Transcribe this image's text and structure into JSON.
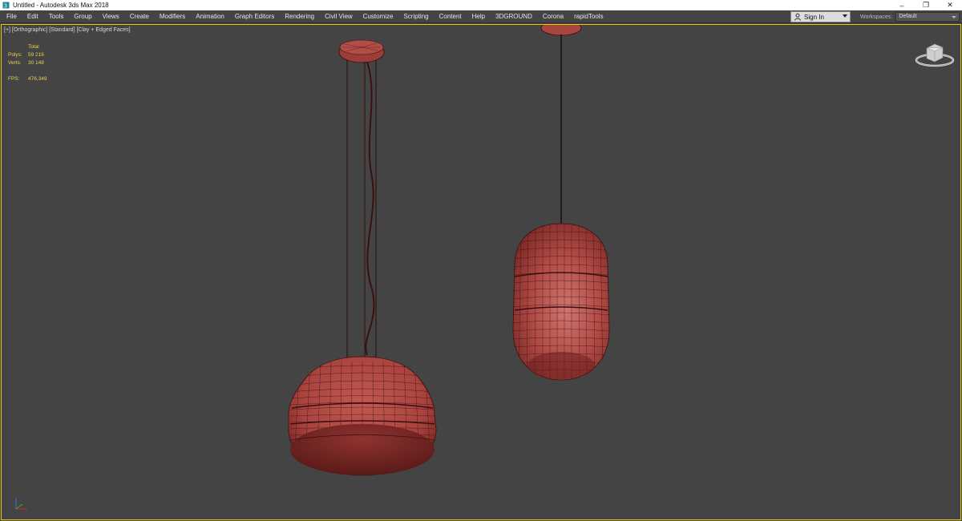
{
  "window": {
    "title": "Untitled - Autodesk 3ds Max 2018",
    "controls": {
      "minimize": "–",
      "restore": "❐",
      "close": "✕"
    }
  },
  "menu": {
    "items": [
      "File",
      "Edit",
      "Tools",
      "Group",
      "Views",
      "Create",
      "Modifiers",
      "Animation",
      "Graph Editors",
      "Rendering",
      "Civil View",
      "Customize",
      "Scripting",
      "Content",
      "Help",
      "3DGROUND",
      "Corona",
      "rapidTools"
    ],
    "signin_label": "Sign In",
    "workspaces_label": "Workspaces:",
    "workspace_value": "Default"
  },
  "viewport": {
    "label": "[+] [Orthographic] [Standard] [Clay + Edged Faces]",
    "stats": {
      "total_label": "Total",
      "polys_label": "Polys:",
      "polys_value": "59 216",
      "verts_label": "Verts:",
      "verts_value": "30 148",
      "fps_label": "FPS:",
      "fps_value": "476,349"
    },
    "clay_color": "#b04a45",
    "wire_color": "#3a0e0e",
    "border_color": "#e8c800"
  }
}
